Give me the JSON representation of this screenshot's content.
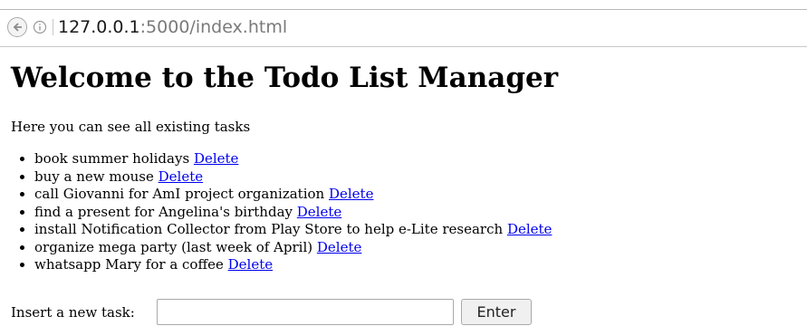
{
  "browser": {
    "url_host": "127.0.0.1",
    "url_rest": ":5000/index.html",
    "icons": {
      "back": "back-arrow-icon",
      "info": "info-icon"
    }
  },
  "page": {
    "title": "Welcome to the Todo List Manager",
    "intro": "Here you can see all existing tasks"
  },
  "tasks": [
    {
      "text": "book summer holidays",
      "delete_label": "Delete"
    },
    {
      "text": "buy a new mouse",
      "delete_label": "Delete"
    },
    {
      "text": "call Giovanni for AmI project organization",
      "delete_label": "Delete"
    },
    {
      "text": "find a present for Angelina's birthday",
      "delete_label": "Delete"
    },
    {
      "text": "install Notification Collector from Play Store to help e-Lite research",
      "delete_label": "Delete"
    },
    {
      "text": "organize mega party (last week of April)",
      "delete_label": "Delete"
    },
    {
      "text": "whatsapp Mary for a coffee",
      "delete_label": "Delete"
    }
  ],
  "form": {
    "label": "Insert a new task:",
    "input_value": "",
    "button_label": "Enter"
  },
  "colors": {
    "link": "#0000ee",
    "url_muted": "#7a7a7a"
  }
}
